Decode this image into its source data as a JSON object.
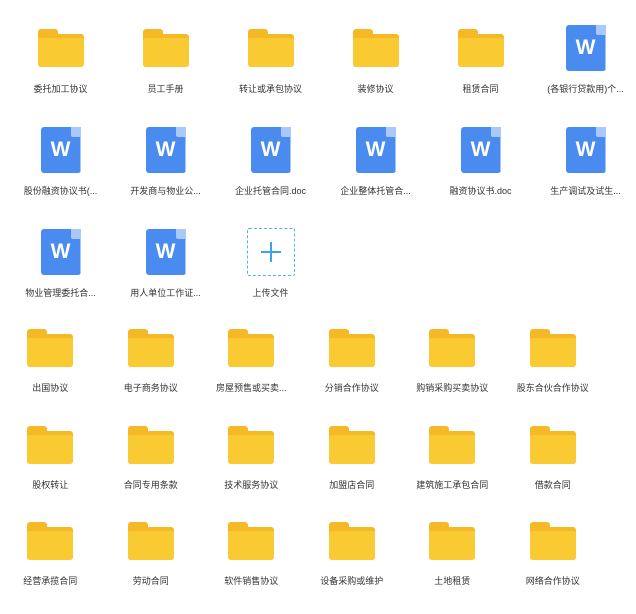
{
  "upload": {
    "label": "上传文件"
  },
  "top_items": [
    {
      "type": "folder",
      "name": "委托加工协议"
    },
    {
      "type": "folder",
      "name": "员工手册"
    },
    {
      "type": "folder",
      "name": "转让或承包协议"
    },
    {
      "type": "folder",
      "name": "装修协议"
    },
    {
      "type": "folder",
      "name": "租赁合同"
    },
    {
      "type": "word",
      "name": "(各银行贷款用)个..."
    },
    {
      "type": "word",
      "name": "股份融资协议书(..."
    },
    {
      "type": "word",
      "name": "开发商与物业公..."
    },
    {
      "type": "word",
      "name": "企业托管合同.doc"
    },
    {
      "type": "word",
      "name": "企业整体托管合..."
    },
    {
      "type": "word",
      "name": "融资协议书.doc"
    },
    {
      "type": "word",
      "name": "生产调试及试生..."
    },
    {
      "type": "word",
      "name": "物业管理委托合..."
    },
    {
      "type": "word",
      "name": "用人单位工作证..."
    }
  ],
  "folders": [
    "出国协议",
    "电子商务协议",
    "房屋预售或买卖...",
    "分销合作协议",
    "购销采购买卖协议",
    "股东合伙合作协议",
    "股权转让",
    "合同专用条款",
    "技术服务协议",
    "加盟店合同",
    "建筑施工承包合同",
    "借款合同",
    "经营承揽合同",
    "劳动合同",
    "软件销售协议",
    "设备采购或维护",
    "土地租赁",
    "网络合作协议"
  ],
  "icons": {
    "folder": "folder-icon",
    "word": "word-document-icon",
    "word_letter": "W",
    "upload": "plus-icon"
  },
  "colors": {
    "folder_front": "#FACA33",
    "folder_back": "#F5B928",
    "word_blue": "#4A8BF0",
    "upload_accent": "#3EA3E8",
    "label_text": "#333333"
  }
}
